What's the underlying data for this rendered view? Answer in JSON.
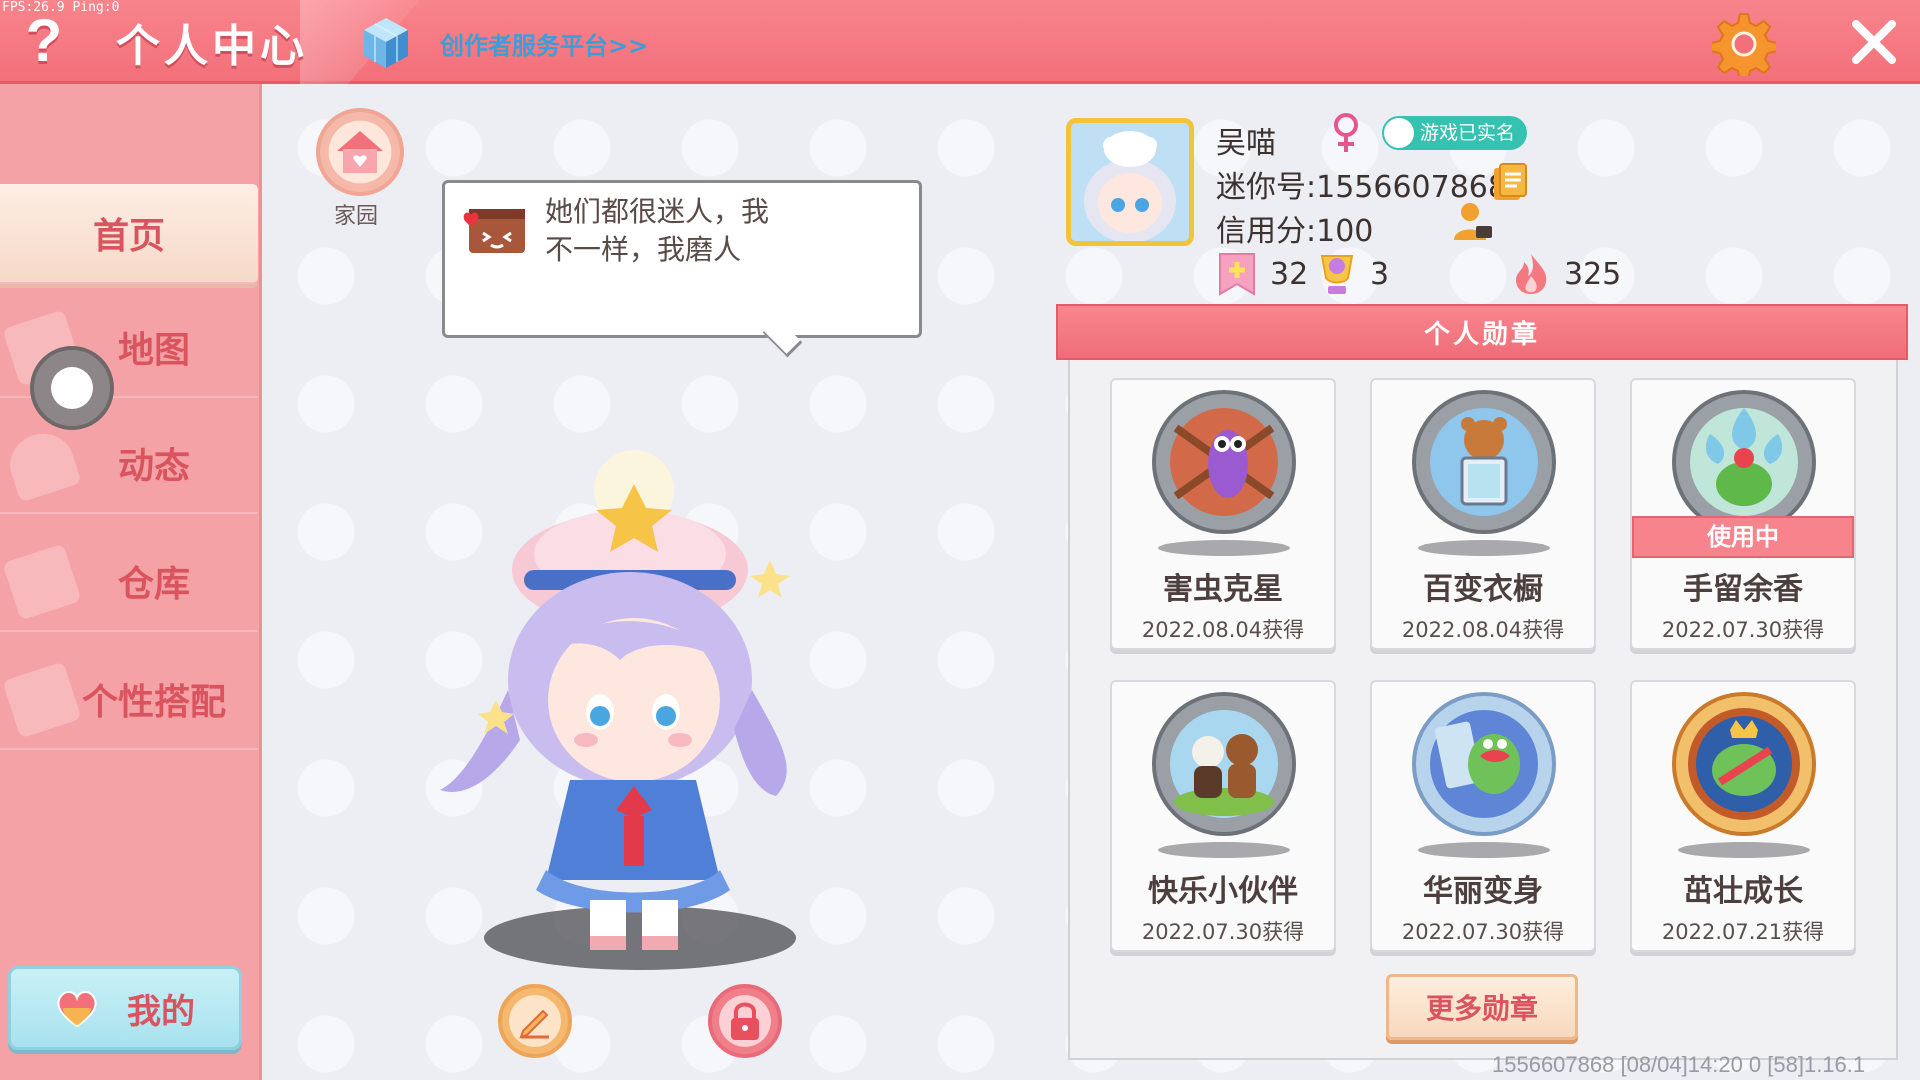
{
  "debug": {
    "fps": "FPS:26.9  Ping:0"
  },
  "header": {
    "help_glyph": "?",
    "title": "个人中心",
    "creator_link": "创作者服务平台>>"
  },
  "sidebar": {
    "items": [
      {
        "label": "首页",
        "active": true
      },
      {
        "label": "地图",
        "active": false
      },
      {
        "label": "动态",
        "active": false
      },
      {
        "label": "仓库",
        "active": false
      },
      {
        "label": "个性搭配",
        "active": false
      }
    ],
    "my_button": "我的"
  },
  "home": {
    "label": "家园"
  },
  "bubble": {
    "text": "她们都很迷人，我不一样，我磨人"
  },
  "profile": {
    "name": "吴喵",
    "realname_badge": "游戏已实名",
    "mini_id": "迷你号:1556607868",
    "credit": "信用分:100",
    "stats": {
      "flags": "32",
      "trophy": "3",
      "fire": "325"
    }
  },
  "medals": {
    "header": "个人勋章",
    "in_use_label": "使用中",
    "items": [
      {
        "name": "害虫克星",
        "date": "2022.08.04获得",
        "icon": "worm-medal-icon",
        "in_use": false
      },
      {
        "name": "百变衣橱",
        "date": "2022.08.04获得",
        "icon": "bear-wardrobe-medal-icon",
        "in_use": false
      },
      {
        "name": "手留余香",
        "date": "2022.07.30获得",
        "icon": "flower-medal-icon",
        "in_use": true
      },
      {
        "name": "快乐小伙伴",
        "date": "2022.07.30获得",
        "icon": "friends-medal-icon",
        "in_use": false
      },
      {
        "name": "华丽变身",
        "date": "2022.07.30获得",
        "icon": "dino-medal-icon",
        "in_use": false
      },
      {
        "name": "茁壮成长",
        "date": "2022.07.21获得",
        "icon": "frog-king-medal-icon",
        "in_use": false
      }
    ],
    "more_button": "更多勋章"
  },
  "footer": {
    "info": "1556607868    [08/04]14:20 0   [58]1.16.1"
  },
  "colors": {
    "topbar": "#f2707a",
    "sidebar": "#f4a2a6",
    "accent_text": "#d9545f",
    "realname": "#36c2b0",
    "creator_link": "#3a9ed8"
  }
}
